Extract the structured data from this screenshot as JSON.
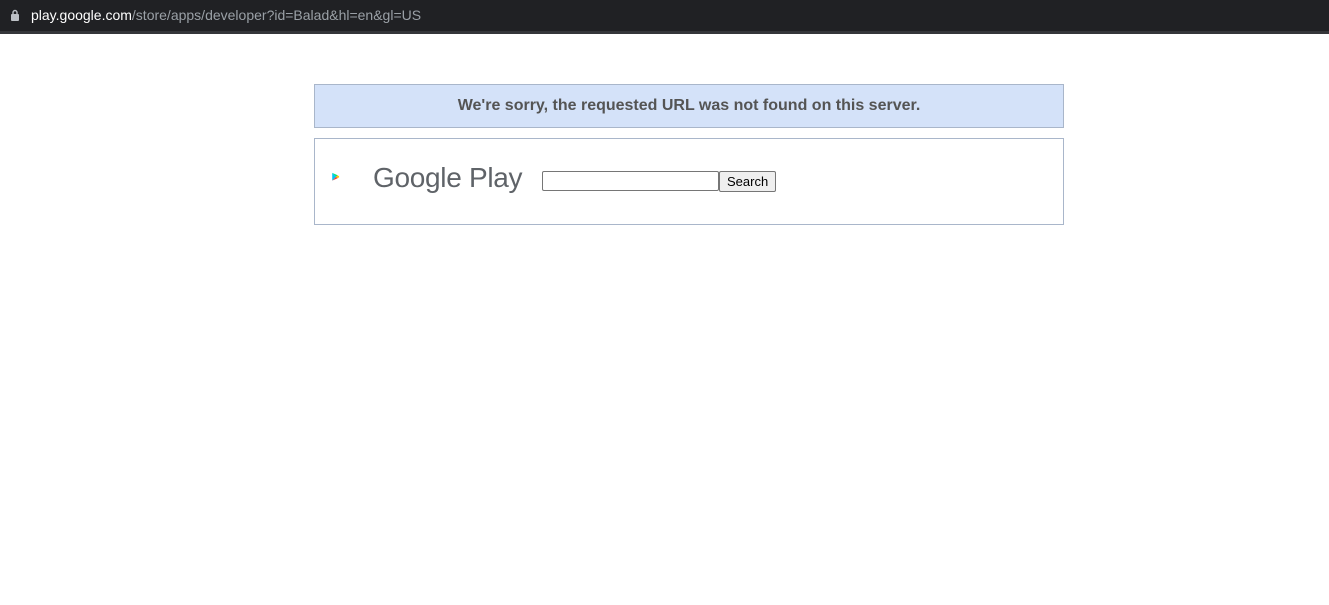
{
  "address_bar": {
    "host": "play.google.com",
    "path": "/store/apps/developer?id=Balad&hl=en&gl=US",
    "icon": "lock-icon"
  },
  "error": {
    "message": "We're sorry, the requested URL was not found on this server."
  },
  "header": {
    "logo_text": "Google Play",
    "logo_icon": "google-play-triangle-icon"
  },
  "search": {
    "value": "",
    "button_label": "Search"
  },
  "colors": {
    "error_bg": "#d4e2f9",
    "border": "#a9b6ca",
    "error_text": "#545454",
    "logo_text": "#5f6368"
  }
}
